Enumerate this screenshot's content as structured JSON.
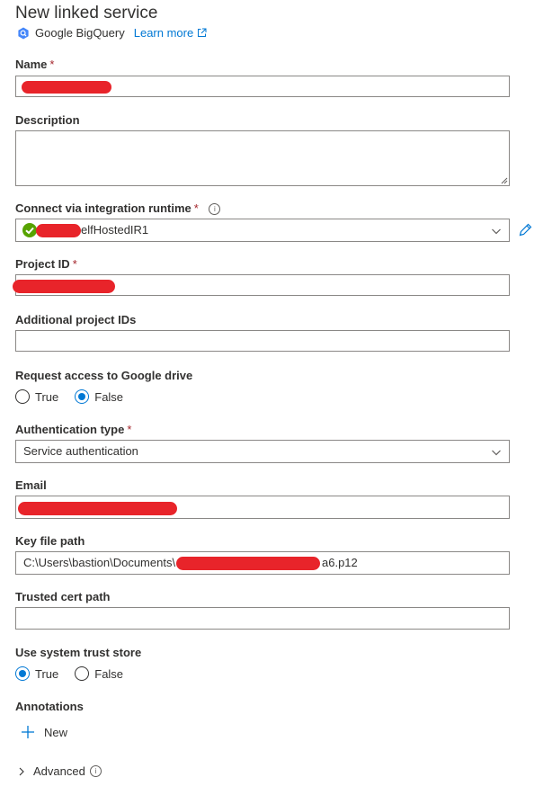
{
  "header": {
    "title": "New linked service",
    "service_name": "Google BigQuery",
    "learn_more": "Learn more"
  },
  "fields": {
    "name": {
      "label": "Name",
      "required": "*"
    },
    "description": {
      "label": "Description"
    },
    "runtime": {
      "label": "Connect via integration runtime",
      "required": "*",
      "value_suffix": "elfHostedIR1"
    },
    "project_id": {
      "label": "Project ID",
      "required": "*"
    },
    "additional_project_ids": {
      "label": "Additional project IDs"
    },
    "google_drive": {
      "label": "Request access to Google drive",
      "options": [
        "True",
        "False"
      ],
      "selected": "False"
    },
    "auth_type": {
      "label": "Authentication type",
      "required": "*",
      "value": "Service authentication"
    },
    "email": {
      "label": "Email"
    },
    "key_file": {
      "label": "Key file path",
      "value_prefix": "C:\\Users\\bastion\\Documents\\",
      "value_suffix": "a6.p12"
    },
    "trusted_cert": {
      "label": "Trusted cert path"
    },
    "system_trust": {
      "label": "Use system trust store",
      "options": [
        "True",
        "False"
      ],
      "selected": "True"
    }
  },
  "annotations": {
    "label": "Annotations",
    "new_button": "New"
  },
  "advanced": {
    "label": "Advanced"
  },
  "icons": {
    "info": "info-icon",
    "edit": "pencil-icon",
    "external": "external-link-icon",
    "status": "check-circle-icon"
  },
  "colors": {
    "accent": "#0078d4",
    "required": "#a4262c",
    "redaction": "#e8242a",
    "success": "#57a300"
  }
}
